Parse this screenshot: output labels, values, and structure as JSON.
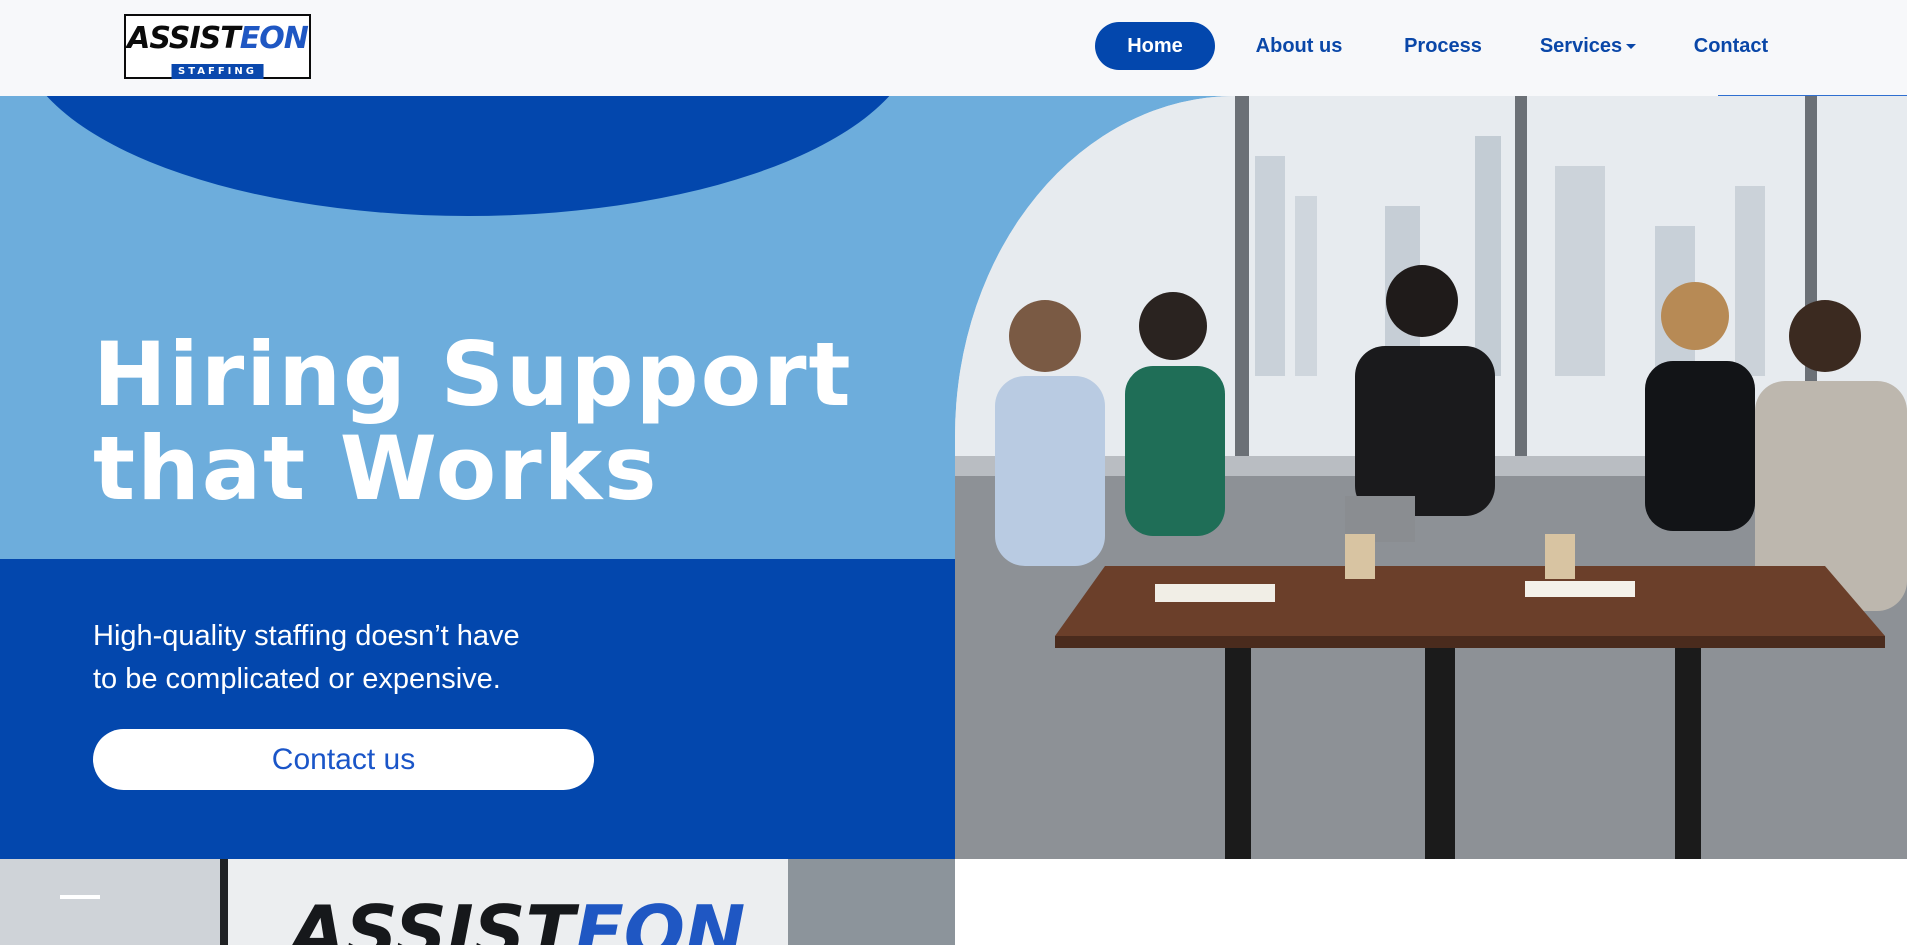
{
  "brand": {
    "logo_word_1": "ASSIST",
    "logo_word_2": "EON",
    "logo_tag": "STAFFING",
    "primary_color": "#0347ad",
    "light_blue": "#6daddc",
    "logo_blue": "#1f57c3"
  },
  "nav": {
    "items": [
      {
        "label": "Home",
        "active": true
      },
      {
        "label": "About us",
        "active": false
      },
      {
        "label": "Process",
        "active": false
      },
      {
        "label": "Services",
        "active": false,
        "has_dropdown": true
      },
      {
        "label": "Contact",
        "active": false
      }
    ]
  },
  "hero": {
    "title_line_1": "Hiring Support",
    "title_line_2": "that Works",
    "subtitle_line_1": "High-quality staffing doesn’t have",
    "subtitle_line_2": "to be complicated or expensive.",
    "cta_label": "Contact us"
  },
  "office_sign": {
    "word_1": "ASSIST",
    "word_2": "EON"
  }
}
